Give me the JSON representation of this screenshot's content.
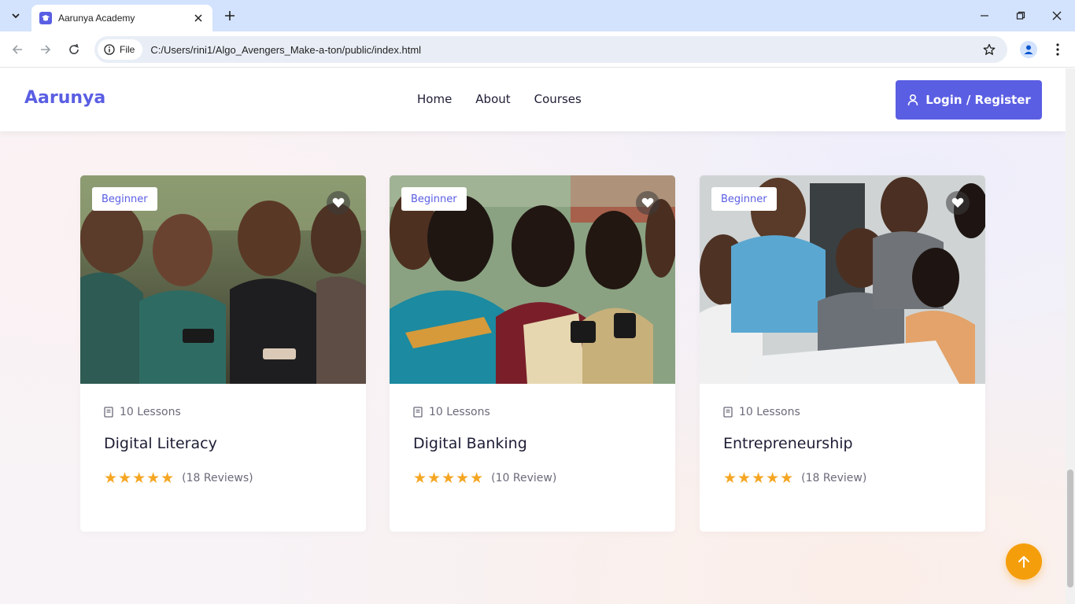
{
  "browser": {
    "tab_title": "Aarunya Academy",
    "site_chip_label": "File",
    "url": "C:/Users/rini1/Algo_Avengers_Make-a-ton/public/index.html"
  },
  "header": {
    "brand": "Aarunya",
    "nav": [
      "Home",
      "About",
      "Courses"
    ],
    "login_label": "Login / Register",
    "accent_color": "#5a5ee3"
  },
  "courses": [
    {
      "level": "Beginner",
      "lessons": "10 Lessons",
      "title": "Digital Literacy",
      "rating": 5,
      "stars": "★★★★★",
      "reviews": "(18 Reviews)",
      "image_icon": "people-using-phones-photo"
    },
    {
      "level": "Beginner",
      "lessons": "10 Lessons",
      "title": "Digital Banking",
      "rating": 5,
      "stars": "★★★★★",
      "reviews": "(10 Review)",
      "image_icon": "women-using-phones-photo"
    },
    {
      "level": "Beginner",
      "lessons": "10 Lessons",
      "title": "Entrepreneurship",
      "rating": 5,
      "stars": "★★★★★",
      "reviews": "(18 Review)",
      "image_icon": "team-meeting-photo"
    }
  ],
  "colors": {
    "star": "#f5a623",
    "back_to_top": "#f59e0b"
  }
}
